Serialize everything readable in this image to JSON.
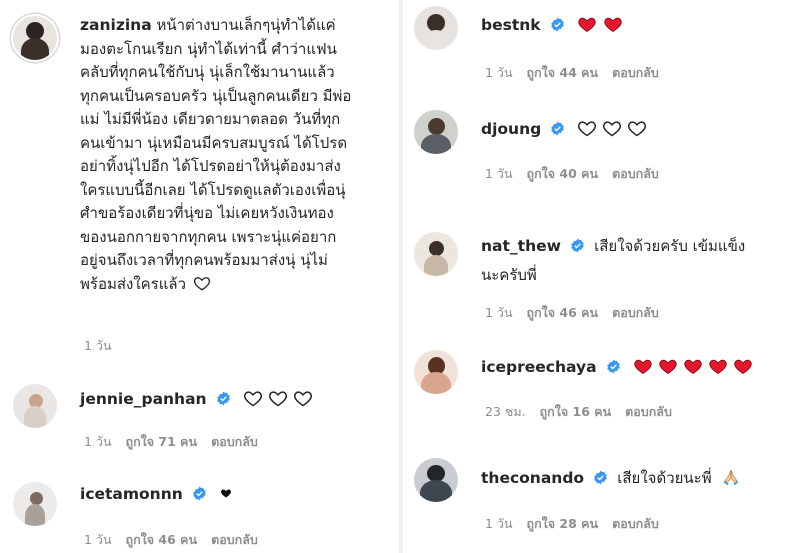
{
  "colors": {
    "accent_blue": "#3897f0",
    "red_heart": "#ed1c3a",
    "meta_gray": "#8e8e8e",
    "text": "#262626"
  },
  "left": {
    "post": {
      "username": "zanizina",
      "text_lines": [
        "หน้าต่างบานเล็กๆนุ่ทำได้แค่",
        "มองตะโกนเรียก นุ่ทำได้เท่านี้ ศำว่าแฟน",
        "คลับที่ทุกคนใช้กับนุ่ นุ่เล็กใช้มานานแล้ว",
        "ทุกคนเป็นครอบครัว นุ่เป็นลูกคนเดียว มีพ่อ",
        "แม่ ไม่มีพี่น้อง เดียวดายมาตลอด วันที่ทุก",
        "คนเข้ามา นุ่เหมือนมีครบสมบูรณ์ ได้โปรด",
        "อย่าทิ้งนุ่ไปอีก ได้โปรดอย่าให้นุ่ต้องมาส่ง",
        "ใครแบบนี้อีกเลย ได้โปรดดูแลตัวเองเพื่อนุ่",
        "ศำขอร้องเดียวที่นุ่ขอ ไม่เคยหวังเงินทอง",
        "ของนอกกายจากทุกคน เพราะนุ่แค่อยาก",
        "อยู่จนถึงเวลาที่ทุกคนพร้อมมาส่งนุ่ นุ่ไม่",
        "พร้อมส่งใครแล้ว"
      ],
      "time": "1 วัน",
      "icon": "outline-heart-icon"
    },
    "comments": [
      {
        "username": "jennie_panhan",
        "text": "",
        "hearts": [
          "outline",
          "outline",
          "outline"
        ],
        "time": "1 วัน",
        "likes": "ถูกใจ 71 คน",
        "reply": "ตอบกลับ"
      },
      {
        "username": "icetamonnn",
        "text": "",
        "hearts": [
          "black"
        ],
        "time": "1 วัน",
        "likes": "ถูกใจ 46 คน",
        "reply": "ตอบกลับ"
      }
    ]
  },
  "right": {
    "comments": [
      {
        "username": "bestnk",
        "text": "",
        "hearts": [
          "red",
          "red"
        ],
        "time": "1 วัน",
        "likes": "ถูกใจ 44 คน",
        "reply": "ตอบกลับ"
      },
      {
        "username": "djoung",
        "text": "",
        "hearts": [
          "outline",
          "outline",
          "outline"
        ],
        "time": "1 วัน",
        "likes": "ถูกใจ 40 คน",
        "reply": "ตอบกลับ"
      },
      {
        "username": "nat_thew",
        "text": "เสียใจด้วยครับ เข้มแข็ง",
        "text2": "นะครับพี่",
        "hearts": [],
        "time": "1 วัน",
        "likes": "ถูกใจ 46 คน",
        "reply": "ตอบกลับ"
      },
      {
        "username": "icepreechaya",
        "text": "",
        "hearts": [
          "red",
          "red",
          "red",
          "red",
          "red"
        ],
        "time": "23 ชม.",
        "likes": "ถูกใจ 16 คน",
        "reply": "ตอบกลับ"
      },
      {
        "username": "theconando",
        "text": "เสียใจด้วยนะพี่",
        "emoji": "🙏",
        "hearts": [],
        "time": "1 วัน",
        "likes": "ถูกใจ 28 คน",
        "reply": "ตอบกลับ"
      }
    ]
  }
}
